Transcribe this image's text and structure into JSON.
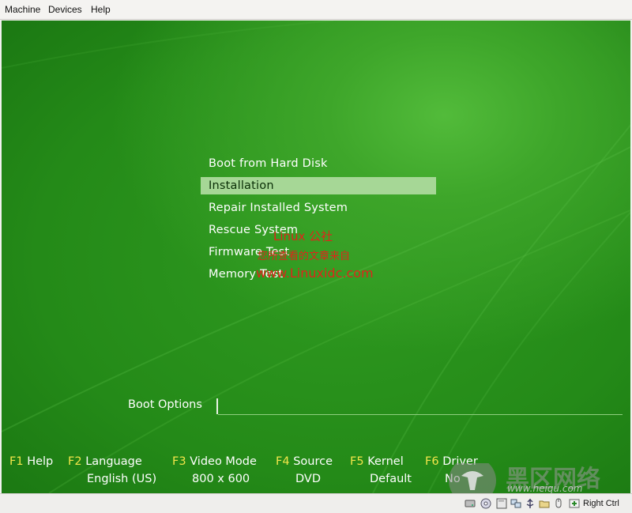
{
  "menubar": {
    "items": [
      "Machine",
      "Devices",
      "Help"
    ]
  },
  "boot_menu": {
    "items": [
      "Boot from Hard Disk",
      "Installation",
      "Repair Installed System",
      "Rescue System",
      "Firmware Test",
      "Memory Test"
    ],
    "selected": "Installation"
  },
  "watermark": {
    "line1": "Linux 公社",
    "line2": "您所查看的文章来自",
    "line3": "www.Linuxidc.com",
    "color": "#e0241b"
  },
  "boot_options": {
    "label": "Boot Options",
    "value": ""
  },
  "function_keys": [
    {
      "key": "F1",
      "label": "Help",
      "value": ""
    },
    {
      "key": "F2",
      "label": "Language",
      "value": "English (US)"
    },
    {
      "key": "F3",
      "label": "Video Mode",
      "value": "800 x 600"
    },
    {
      "key": "F4",
      "label": "Source",
      "value": "DVD"
    },
    {
      "key": "F5",
      "label": "Kernel",
      "value": "Default"
    },
    {
      "key": "F6",
      "label": "Driver",
      "value": "No"
    }
  ],
  "overlay_logo": {
    "text": "黑区网络",
    "url": "www.heiqu.com"
  },
  "statusbar": {
    "icons": [
      "hard-disk-icon",
      "optical-disk-icon",
      "floppy-icon",
      "network-icon",
      "usb-icon",
      "shared-folder-icon",
      "mouse-integration-icon",
      "host-key-icon"
    ],
    "host_key": "Right Ctrl"
  },
  "colors": {
    "green_bg": "#248a18",
    "selection": "#a6d796",
    "fkey_yellow": "#f3e54a"
  }
}
